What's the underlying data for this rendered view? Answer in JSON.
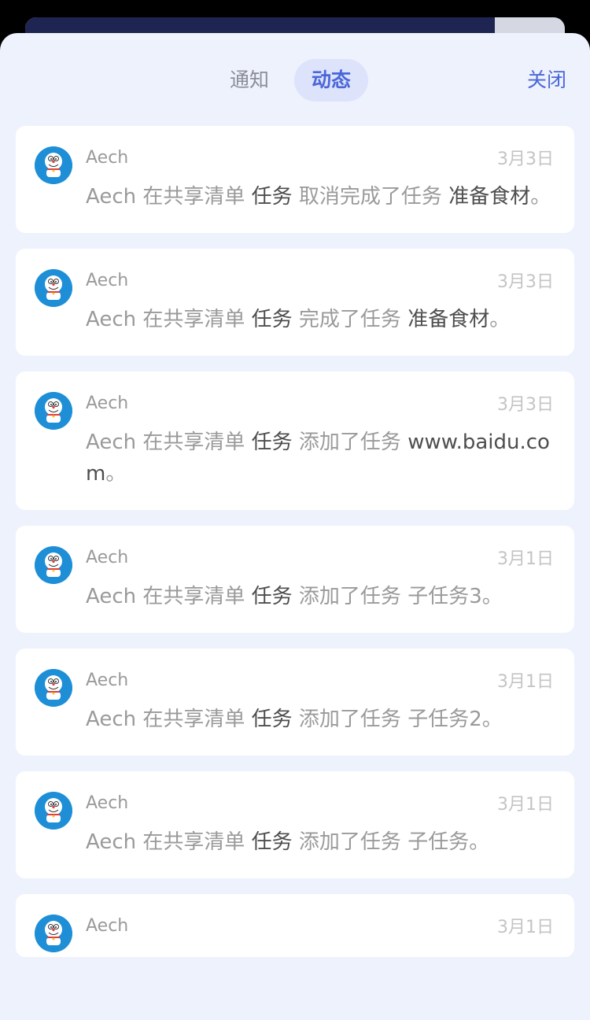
{
  "header": {
    "tabs": [
      {
        "label": "通知",
        "active": false
      },
      {
        "label": "动态",
        "active": true
      }
    ],
    "close_label": "关闭"
  },
  "background_card": {
    "fill_percent": 87
  },
  "feed": [
    {
      "user": "Aech",
      "date": "3月3日",
      "text": [
        {
          "t": "Aech 在共享清单 ",
          "strong": false
        },
        {
          "t": "任务",
          "strong": true
        },
        {
          "t": " 取消完成了任务 ",
          "strong": false
        },
        {
          "t": "准备食材",
          "strong": true
        },
        {
          "t": "。",
          "strong": false
        }
      ]
    },
    {
      "user": "Aech",
      "date": "3月3日",
      "text": [
        {
          "t": "Aech 在共享清单 ",
          "strong": false
        },
        {
          "t": "任务",
          "strong": true
        },
        {
          "t": " 完成了任务 ",
          "strong": false
        },
        {
          "t": "准备食材",
          "strong": true
        },
        {
          "t": "。",
          "strong": false
        }
      ]
    },
    {
      "user": "Aech",
      "date": "3月3日",
      "text": [
        {
          "t": "Aech 在共享清单 ",
          "strong": false
        },
        {
          "t": "任务",
          "strong": true
        },
        {
          "t": " 添加了任务 ",
          "strong": false
        },
        {
          "t": "www.baidu.com",
          "strong": true
        },
        {
          "t": "。",
          "strong": false
        }
      ]
    },
    {
      "user": "Aech",
      "date": "3月1日",
      "text": [
        {
          "t": "Aech 在共享清单 ",
          "strong": false
        },
        {
          "t": "任务",
          "strong": true
        },
        {
          "t": " 添加了任务 ",
          "strong": false
        },
        {
          "t": "子任务3",
          "strong": false
        },
        {
          "t": "。",
          "strong": false
        }
      ]
    },
    {
      "user": "Aech",
      "date": "3月1日",
      "text": [
        {
          "t": "Aech 在共享清单 ",
          "strong": false
        },
        {
          "t": "任务",
          "strong": true
        },
        {
          "t": " 添加了任务 ",
          "strong": false
        },
        {
          "t": "子任务2",
          "strong": false
        },
        {
          "t": "。",
          "strong": false
        }
      ]
    },
    {
      "user": "Aech",
      "date": "3月1日",
      "text": [
        {
          "t": "Aech 在共享清单 ",
          "strong": false
        },
        {
          "t": "任务",
          "strong": true
        },
        {
          "t": " 添加了任务 ",
          "strong": false
        },
        {
          "t": "子任务",
          "strong": false
        },
        {
          "t": "。",
          "strong": false
        }
      ]
    },
    {
      "user": "Aech",
      "date": "3月1日",
      "text": []
    }
  ],
  "colors": {
    "accent": "#4a67d8",
    "sheet_bg": "#eef2fc",
    "avatar_bg": "#1e8fd6"
  }
}
